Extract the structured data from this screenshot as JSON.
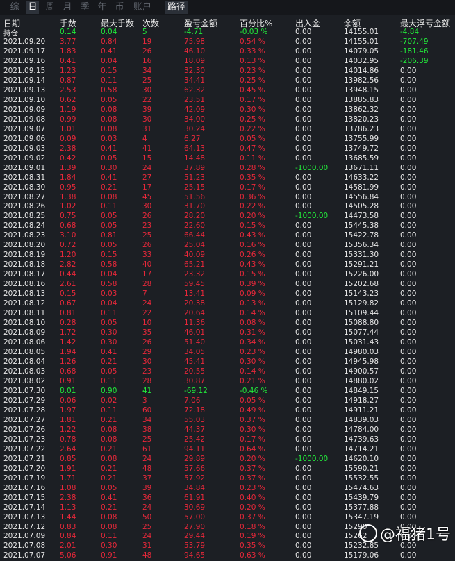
{
  "colors": {
    "profit": "#e8283a",
    "loss": "#22e83a",
    "neutral": "#e6e6e6",
    "background": "#1c1f24"
  },
  "tabs": [
    "综",
    "日",
    "周",
    "月",
    "季",
    "年",
    "币",
    "账户",
    "路径"
  ],
  "headers": [
    "日期",
    "手数",
    "最大手数",
    "次数",
    "盈亏金额",
    "百分比%",
    "出入金",
    "余额",
    "最大浮亏金额"
  ],
  "summary": [
    "持仓",
    "0.14",
    "0.04",
    "5",
    "-4.71",
    "-0.03 %",
    "0.00",
    "14155.01",
    "-4.84"
  ],
  "rows": [
    [
      "2021.09.20",
      "3.77",
      "0.84",
      "19",
      "75.98",
      "0.54 %",
      "0.00",
      "14155.01",
      "-707.49"
    ],
    [
      "2021.09.17",
      "1.83",
      "0.41",
      "26",
      "46.10",
      "0.33 %",
      "0.00",
      "14079.05",
      "-181.46"
    ],
    [
      "2021.09.16",
      "0.41",
      "0.04",
      "16",
      "18.09",
      "0.13 %",
      "0.00",
      "14032.95",
      "-206.39"
    ],
    [
      "2021.09.15",
      "1.23",
      "0.15",
      "34",
      "32.30",
      "0.23 %",
      "0.00",
      "14014.86",
      "0.00"
    ],
    [
      "2021.09.14",
      "0.87",
      "0.11",
      "25",
      "34.41",
      "0.25 %",
      "0.00",
      "13982.56",
      "0.00"
    ],
    [
      "2021.09.13",
      "2.53",
      "0.58",
      "30",
      "62.32",
      "0.45 %",
      "0.00",
      "13948.15",
      "0.00"
    ],
    [
      "2021.09.10",
      "0.62",
      "0.05",
      "22",
      "23.51",
      "0.17 %",
      "0.00",
      "13885.83",
      "0.00"
    ],
    [
      "2021.09.09",
      "1.19",
      "0.08",
      "39",
      "42.09",
      "0.30 %",
      "0.00",
      "13862.32",
      "0.00"
    ],
    [
      "2021.09.08",
      "0.99",
      "0.08",
      "30",
      "34.00",
      "0.25 %",
      "0.00",
      "13820.23",
      "0.00"
    ],
    [
      "2021.09.07",
      "1.01",
      "0.08",
      "31",
      "30.24",
      "0.22 %",
      "0.00",
      "13786.23",
      "0.00"
    ],
    [
      "2021.09.06",
      "0.09",
      "0.03",
      "4",
      "6.27",
      "0.05 %",
      "0.00",
      "13755.99",
      "0.00"
    ],
    [
      "2021.09.03",
      "2.38",
      "0.41",
      "41",
      "64.13",
      "0.47 %",
      "0.00",
      "13749.72",
      "0.00"
    ],
    [
      "2021.09.02",
      "0.42",
      "0.05",
      "15",
      "14.48",
      "0.11 %",
      "0.00",
      "13685.59",
      "0.00"
    ],
    [
      "2021.09.01",
      "1.39",
      "0.30",
      "24",
      "37.89",
      "0.28 %",
      "-1000.00",
      "13671.11",
      "0.00"
    ],
    [
      "2021.08.31",
      "1.84",
      "0.41",
      "27",
      "51.23",
      "0.35 %",
      "0.00",
      "14633.22",
      "0.00"
    ],
    [
      "2021.08.30",
      "0.95",
      "0.21",
      "17",
      "25.15",
      "0.17 %",
      "0.00",
      "14581.99",
      "0.00"
    ],
    [
      "2021.08.27",
      "1.38",
      "0.08",
      "45",
      "51.56",
      "0.36 %",
      "0.00",
      "14556.84",
      "0.00"
    ],
    [
      "2021.08.26",
      "1.02",
      "0.11",
      "30",
      "31.70",
      "0.22 %",
      "0.00",
      "14505.28",
      "0.00"
    ],
    [
      "2021.08.25",
      "0.75",
      "0.05",
      "26",
      "28.20",
      "0.20 %",
      "-1000.00",
      "14473.58",
      "0.00"
    ],
    [
      "2021.08.24",
      "0.68",
      "0.05",
      "23",
      "22.60",
      "0.15 %",
      "0.00",
      "15445.38",
      "0.00"
    ],
    [
      "2021.08.23",
      "3.10",
      "0.81",
      "25",
      "66.44",
      "0.43 %",
      "0.00",
      "15422.78",
      "0.00"
    ],
    [
      "2021.08.20",
      "0.72",
      "0.05",
      "26",
      "25.04",
      "0.16 %",
      "0.00",
      "15356.34",
      "0.00"
    ],
    [
      "2021.08.19",
      "1.20",
      "0.15",
      "33",
      "40.09",
      "0.26 %",
      "0.00",
      "15331.30",
      "0.00"
    ],
    [
      "2021.08.18",
      "2.82",
      "0.58",
      "40",
      "65.21",
      "0.43 %",
      "0.00",
      "15291.21",
      "0.00"
    ],
    [
      "2021.08.17",
      "0.44",
      "0.04",
      "17",
      "23.32",
      "0.15 %",
      "0.00",
      "15226.00",
      "0.00"
    ],
    [
      "2021.08.16",
      "2.61",
      "0.58",
      "28",
      "59.45",
      "0.39 %",
      "0.00",
      "15202.68",
      "0.00"
    ],
    [
      "2021.08.13",
      "0.15",
      "0.03",
      "7",
      "13.41",
      "0.09 %",
      "0.00",
      "15143.23",
      "0.00"
    ],
    [
      "2021.08.12",
      "0.67",
      "0.04",
      "24",
      "20.38",
      "0.13 %",
      "0.00",
      "15129.82",
      "0.00"
    ],
    [
      "2021.08.11",
      "0.81",
      "0.11",
      "22",
      "20.64",
      "0.14 %",
      "0.00",
      "15109.44",
      "0.00"
    ],
    [
      "2021.08.10",
      "0.28",
      "0.05",
      "10",
      "11.36",
      "0.08 %",
      "0.00",
      "15088.80",
      "0.00"
    ],
    [
      "2021.08.09",
      "1.72",
      "0.30",
      "35",
      "46.01",
      "0.31 %",
      "0.00",
      "15077.44",
      "0.00"
    ],
    [
      "2021.08.06",
      "1.42",
      "0.30",
      "26",
      "51.40",
      "0.34 %",
      "0.00",
      "15031.43",
      "0.00"
    ],
    [
      "2021.08.05",
      "1.94",
      "0.41",
      "29",
      "34.05",
      "0.23 %",
      "0.00",
      "14980.03",
      "0.00"
    ],
    [
      "2021.08.04",
      "1.26",
      "0.21",
      "30",
      "45.41",
      "0.30 %",
      "0.00",
      "14945.98",
      "0.00"
    ],
    [
      "2021.08.03",
      "0.68",
      "0.05",
      "23",
      "20.55",
      "0.14 %",
      "0.00",
      "14900.57",
      "0.00"
    ],
    [
      "2021.08.02",
      "0.91",
      "0.11",
      "28",
      "30.87",
      "0.21 %",
      "0.00",
      "14880.02",
      "0.00"
    ],
    [
      "2021.07.30",
      "8.01",
      "0.90",
      "41",
      "-69.12",
      "-0.46 %",
      "0.00",
      "14849.15",
      "0.00"
    ],
    [
      "2021.07.29",
      "0.06",
      "0.02",
      "3",
      "7.06",
      "0.05 %",
      "0.00",
      "14918.27",
      "0.00"
    ],
    [
      "2021.07.28",
      "1.97",
      "0.11",
      "60",
      "72.18",
      "0.49 %",
      "0.00",
      "14911.21",
      "0.00"
    ],
    [
      "2021.07.27",
      "1.81",
      "0.21",
      "34",
      "55.03",
      "0.37 %",
      "0.00",
      "14839.03",
      "0.00"
    ],
    [
      "2021.07.26",
      "1.22",
      "0.08",
      "38",
      "44.37",
      "0.30 %",
      "0.00",
      "14784.00",
      "0.00"
    ],
    [
      "2021.07.23",
      "0.78",
      "0.08",
      "25",
      "25.42",
      "0.17 %",
      "0.00",
      "14739.63",
      "0.00"
    ],
    [
      "2021.07.22",
      "2.64",
      "0.21",
      "61",
      "94.11",
      "0.64 %",
      "0.00",
      "14714.21",
      "0.00"
    ],
    [
      "2021.07.21",
      "0.85",
      "0.08",
      "24",
      "29.89",
      "0.20 %",
      "-1000.00",
      "14620.10",
      "0.00"
    ],
    [
      "2021.07.20",
      "1.91",
      "0.21",
      "48",
      "57.66",
      "0.37 %",
      "0.00",
      "15590.21",
      "0.00"
    ],
    [
      "2021.07.19",
      "1.71",
      "0.21",
      "37",
      "57.92",
      "0.37 %",
      "0.00",
      "15532.55",
      "0.00"
    ],
    [
      "2021.07.16",
      "1.08",
      "0.05",
      "39",
      "34.84",
      "0.23 %",
      "0.00",
      "15474.63",
      "0.00"
    ],
    [
      "2021.07.15",
      "2.38",
      "0.41",
      "36",
      "61.91",
      "0.40 %",
      "0.00",
      "15439.79",
      "0.00"
    ],
    [
      "2021.07.14",
      "1.13",
      "0.21",
      "24",
      "30.69",
      "0.20 %",
      "0.00",
      "15377.88",
      "0.00"
    ],
    [
      "2021.07.13",
      "1.44",
      "0.08",
      "50",
      "57.00",
      "0.37 %",
      "0.00",
      "15347.19",
      "0.00"
    ],
    [
      "2021.07.12",
      "0.83",
      "0.08",
      "25",
      "27.90",
      "0.18 %",
      "0.00",
      "15290",
      "0.00"
    ],
    [
      "2021.07.09",
      "0.84",
      "0.11",
      "24",
      "29.44",
      "0.19 %",
      "0.00",
      "15262",
      "0.00"
    ],
    [
      "2021.07.08",
      "2.01",
      "0.30",
      "31",
      "53.79",
      "0.35 %",
      "0.00",
      "15232.85",
      "0.00"
    ],
    [
      "2021.07.07",
      "5.06",
      "0.91",
      "48",
      "94.65",
      "0.63 %",
      "0.00",
      "15179.06",
      "0.00"
    ]
  ],
  "watermark": {
    "text": "@福猪1号"
  }
}
